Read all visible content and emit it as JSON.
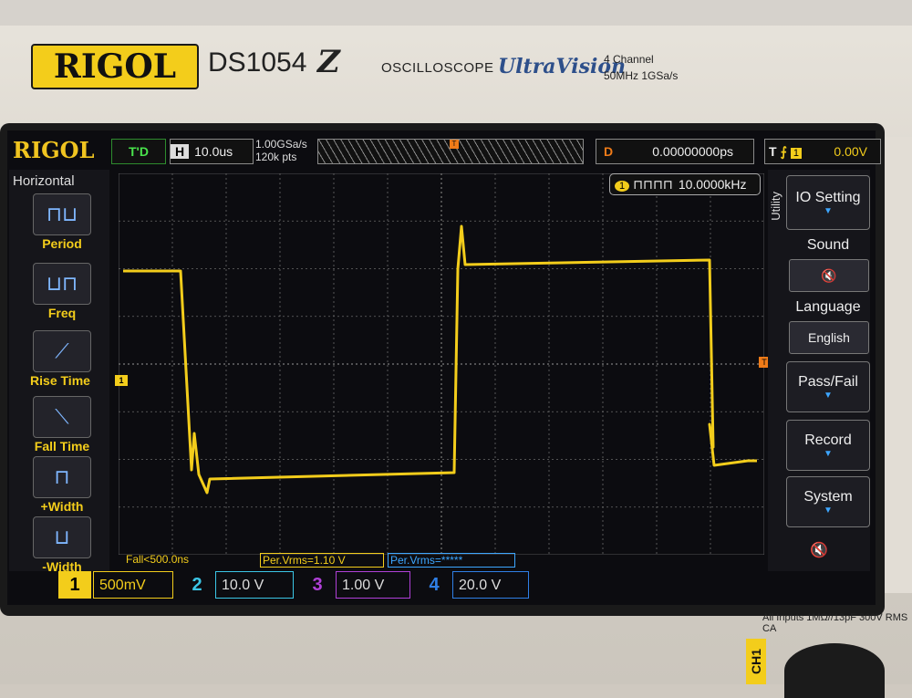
{
  "device": {
    "brand": "RIGOL",
    "model": "DS1054",
    "model_suffix": "Z",
    "type_label": "OSCILLOSCOPE",
    "series": "UltraVision",
    "spec_line1": "4 Channel",
    "spec_line2": "50MHz  1GSa/s",
    "input_spec": "All Inputs 1MΩ//13pF 300V RMS  CA",
    "ch1_label": "CH1"
  },
  "status": {
    "brand": "RIGOL",
    "run_state": "T'D",
    "horiz_key": "H",
    "timebase": "10.0us",
    "sample_rate": "1.00GSa/s",
    "mem_depth": "120k pts",
    "delay_key": "D",
    "delay": "0.00000000ps",
    "trig_key": "T",
    "trig_slope": "⨍",
    "trig_chan": "1",
    "trig_level": "0.00V"
  },
  "left_menu": {
    "title": "Horizontal",
    "items": [
      {
        "label": "Period",
        "icon": "period-icon",
        "glyph": "⊓⊔"
      },
      {
        "label": "Freq",
        "icon": "freq-icon",
        "glyph": "⊔⊓"
      },
      {
        "label": "Rise Time",
        "icon": "rise-time-icon",
        "glyph": "⟋"
      },
      {
        "label": "Fall Time",
        "icon": "fall-time-icon",
        "glyph": "⟍"
      },
      {
        "label": "+Width",
        "icon": "pos-width-icon",
        "glyph": "⊓"
      },
      {
        "label": "-Width",
        "icon": "neg-width-icon",
        "glyph": "⊔"
      }
    ]
  },
  "right_menu": {
    "title": "Utility",
    "io": "IO Setting",
    "sound_label": "Sound",
    "sound_value": "🔇",
    "language_label": "Language",
    "language_value": "English",
    "passfail": "Pass/Fail",
    "record": "Record",
    "system": "System"
  },
  "freq_counter": {
    "channel": "1",
    "glyph": "⊓⊓⊓⊓",
    "value": "10.0000kHz"
  },
  "markers": {
    "ch1": "1",
    "trigger": "T"
  },
  "measurements": {
    "fall": "Fall<500.0ns",
    "vrms1": "Per.Vrms=1.10 V",
    "vrms2": "Per.Vrms=*****"
  },
  "channels": [
    {
      "num": "1",
      "scale": "500mV",
      "color": "#f3cd1b"
    },
    {
      "num": "2",
      "scale": "10.0 V",
      "color": "#3bc6e6"
    },
    {
      "num": "3",
      "scale": "1.00 V",
      "color": "#b040d8"
    },
    {
      "num": "4",
      "scale": "20.0 V",
      "color": "#2f7fe6"
    }
  ],
  "speaker_icon": "🔇",
  "colors": {
    "trace": "#f3cd1b",
    "grid": "#6a6a6a",
    "accent": "#3da6ff",
    "trigger": "#f07b18"
  }
}
